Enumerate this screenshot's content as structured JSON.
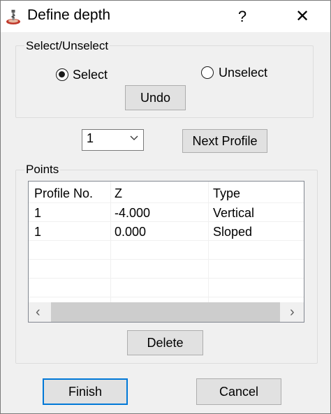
{
  "window": {
    "title": "Define depth",
    "help_label": "?",
    "close_label": "✕",
    "icon": "milling-tool-icon"
  },
  "select_group": {
    "label": "Select/Unselect",
    "select_label": "Select",
    "unselect_label": "Unselect",
    "selected": "Select",
    "undo_label": "Undo"
  },
  "profile": {
    "selected_value": "1",
    "next_label": "Next Profile"
  },
  "points_group": {
    "label": "Points",
    "columns": [
      "Profile No.",
      "Z",
      "Type"
    ],
    "rows": [
      [
        "1",
        "-4.000",
        "Vertical"
      ],
      [
        "1",
        "0.000",
        "Sloped"
      ]
    ],
    "scroll_left": "‹",
    "scroll_right": "›",
    "delete_label": "Delete"
  },
  "footer": {
    "finish_label": "Finish",
    "cancel_label": "Cancel"
  },
  "colors": {
    "accent": "#0078d7",
    "icon_red": "#c0392b"
  }
}
